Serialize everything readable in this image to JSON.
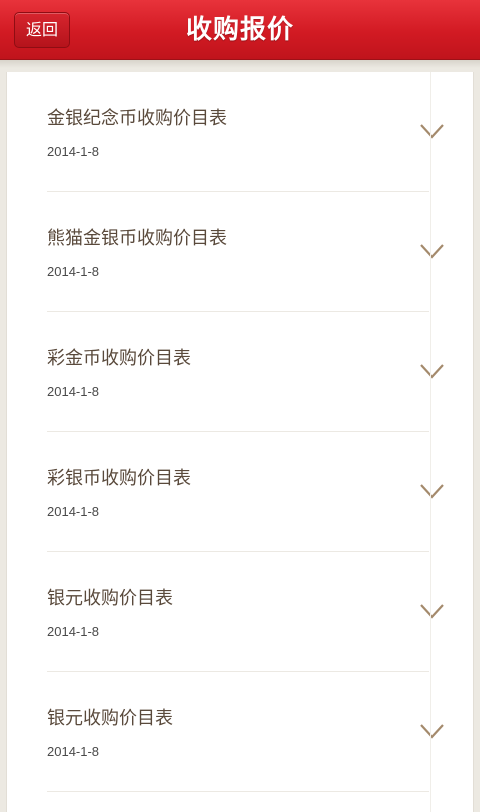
{
  "header": {
    "back_label": "返回",
    "title": "收购报价"
  },
  "items": [
    {
      "title": "金银纪念币收购价目表",
      "date": "2014-1-8"
    },
    {
      "title": "熊猫金银币收购价目表",
      "date": "2014-1-8"
    },
    {
      "title": "彩金币收购价目表",
      "date": "2014-1-8"
    },
    {
      "title": "彩银币收购价目表",
      "date": "2014-1-8"
    },
    {
      "title": "银元收购价目表",
      "date": "2014-1-8"
    },
    {
      "title": "银元收购价目表",
      "date": "2014-1-8"
    }
  ],
  "colors": {
    "header_red": "#d21a23",
    "title_text": "#5a4a3c",
    "chevron": "#a48a6c"
  },
  "icons": {
    "expand": "chevron-down-icon"
  }
}
